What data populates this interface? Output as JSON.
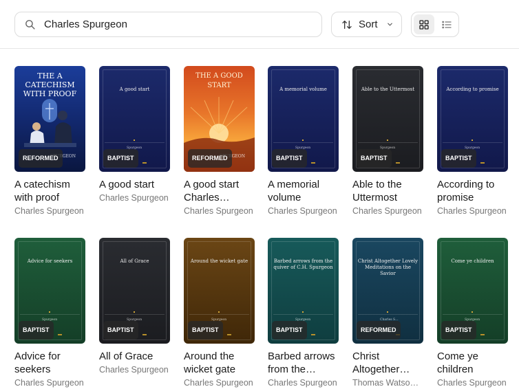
{
  "search": {
    "value": "Charles Spurgeon",
    "placeholder": ""
  },
  "toolbar": {
    "sort_label": "Sort"
  },
  "books": [
    {
      "title": "A catechism with proof",
      "author": "Charles Spurgeon",
      "badge": "REFORMED",
      "cover_title": "THE A CATECHISM WITH PROOF",
      "cover_author": "SPURGEON",
      "cover_style": "art-blue"
    },
    {
      "title": "A good start",
      "author": "Charles Spurgeon",
      "badge": "BAPTIST",
      "cover_title": "A good start",
      "cover_author": "Spurgeon",
      "cover_style": "navy"
    },
    {
      "title": "A good start Charles…",
      "author": "Charles Spurgeon",
      "badge": "REFORMED",
      "cover_title": "THE A GOOD START",
      "cover_author": "SPURGEON",
      "cover_style": "art-red"
    },
    {
      "title": "A memorial volume",
      "author": "Charles Spurgeon",
      "badge": "BAPTIST",
      "cover_title": "A memorial volume",
      "cover_author": "Spurgeon",
      "cover_style": "navy"
    },
    {
      "title": "Able to the Uttermost",
      "author": "Charles Spurgeon",
      "badge": "BAPTIST",
      "cover_title": "Able to the Uttermost",
      "cover_author": "Spurgeon",
      "cover_style": "charcoal"
    },
    {
      "title": "According to promise",
      "author": "Charles Spurgeon",
      "badge": "BAPTIST",
      "cover_title": "According to promise",
      "cover_author": "Spurgeon",
      "cover_style": "navy"
    },
    {
      "title": "Advice for seekers",
      "author": "Charles Spurgeon",
      "badge": "BAPTIST",
      "cover_title": "Advice for seekers",
      "cover_author": "Spurgeon",
      "cover_style": "green"
    },
    {
      "title": "All of Grace",
      "author": "Charles Spurgeon",
      "badge": "BAPTIST",
      "cover_title": "All of Grace",
      "cover_author": "Spurgeon",
      "cover_style": "charcoal"
    },
    {
      "title": "Around the wicket gate",
      "author": "Charles Spurgeon",
      "badge": "BAPTIST",
      "cover_title": "Around the wicket gate",
      "cover_author": "Spurgeon",
      "cover_style": "brown"
    },
    {
      "title": "Barbed arrows from the…",
      "author": "Charles Spurgeon",
      "badge": "BAPTIST",
      "cover_title": "Barbed arrows from the quiver of C.H. Spurgeon",
      "cover_author": "Spurgeon",
      "cover_style": "teal"
    },
    {
      "title": "Christ Altogether…",
      "author": "Thomas Watson,…",
      "badge": "REFORMED",
      "cover_title": "Christ Altogether Lovely Meditations on the Savior",
      "cover_author": "Charles S…",
      "cover_style": "deepteal"
    },
    {
      "title": "Come ye children",
      "author": "Charles Spurgeon",
      "badge": "BAPTIST",
      "cover_title": "Come ye children",
      "cover_author": "Spurgeon",
      "cover_style": "green"
    }
  ]
}
